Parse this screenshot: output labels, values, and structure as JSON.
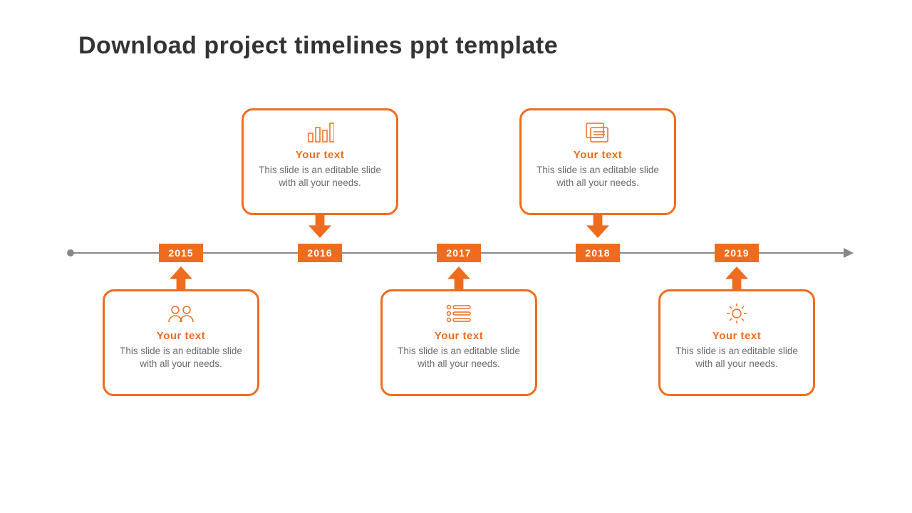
{
  "title": "Download project timelines ppt template",
  "colors": {
    "accent": "#ef6c1f",
    "axis": "#888888",
    "title": "#333333",
    "body": "#6b6b6b"
  },
  "timeline": {
    "years": [
      "2015",
      "2016",
      "2017",
      "2018",
      "2019"
    ],
    "items": [
      {
        "year": "2015",
        "position": "below",
        "icon": "people-icon",
        "heading": "Your text",
        "body": "This slide is an editable slide with all your needs."
      },
      {
        "year": "2016",
        "position": "above",
        "icon": "bar-chart-icon",
        "heading": "Your text",
        "body": "This slide is an editable slide with all your needs."
      },
      {
        "year": "2017",
        "position": "below",
        "icon": "list-icon",
        "heading": "Your text",
        "body": "This slide is an editable slide with all your needs."
      },
      {
        "year": "2018",
        "position": "above",
        "icon": "document-icon",
        "heading": "Your text",
        "body": "This slide is an editable slide with all your needs."
      },
      {
        "year": "2019",
        "position": "below",
        "icon": "gear-icon",
        "heading": "Your text",
        "body": "This slide is an editable slide with all your needs."
      }
    ]
  }
}
